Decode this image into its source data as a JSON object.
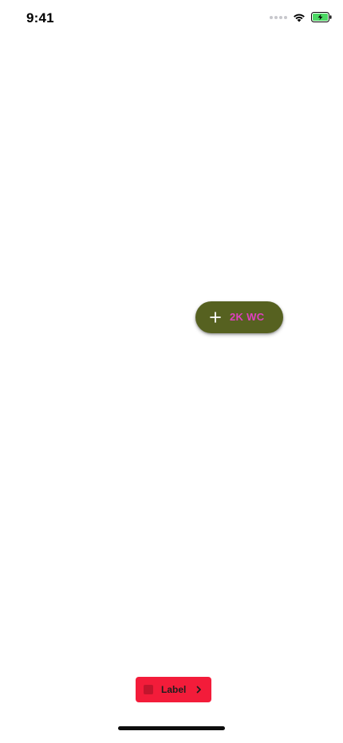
{
  "status_bar": {
    "time": "9:41",
    "icons": [
      "signal-icon",
      "wifi-icon",
      "battery-charging-icon"
    ],
    "battery_color": "#4cd964"
  },
  "fab": {
    "icon": "plus-icon",
    "label": "2K WC",
    "background": "#566120",
    "label_color": "#e040c0"
  },
  "chip_button": {
    "icon": "square-icon",
    "label": "Label",
    "trailing_icon": "chevron-right-icon",
    "background": "#f31c3a"
  }
}
